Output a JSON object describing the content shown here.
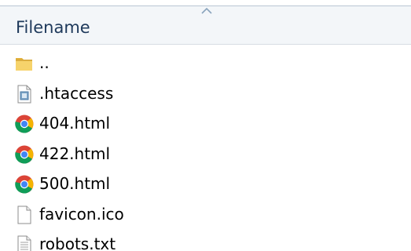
{
  "header": {
    "column_label": "Filename",
    "sort_direction": "ascending",
    "accent_color": "#1e395b"
  },
  "files": [
    {
      "name": "..",
      "icon": "folder-icon"
    },
    {
      "name": ".htaccess",
      "icon": "config-file-icon"
    },
    {
      "name": "404.html",
      "icon": "chrome-icon"
    },
    {
      "name": "422.html",
      "icon": "chrome-icon"
    },
    {
      "name": "500.html",
      "icon": "chrome-icon"
    },
    {
      "name": "favicon.ico",
      "icon": "blank-file-icon"
    },
    {
      "name": "robots.txt",
      "icon": "text-file-icon"
    }
  ]
}
